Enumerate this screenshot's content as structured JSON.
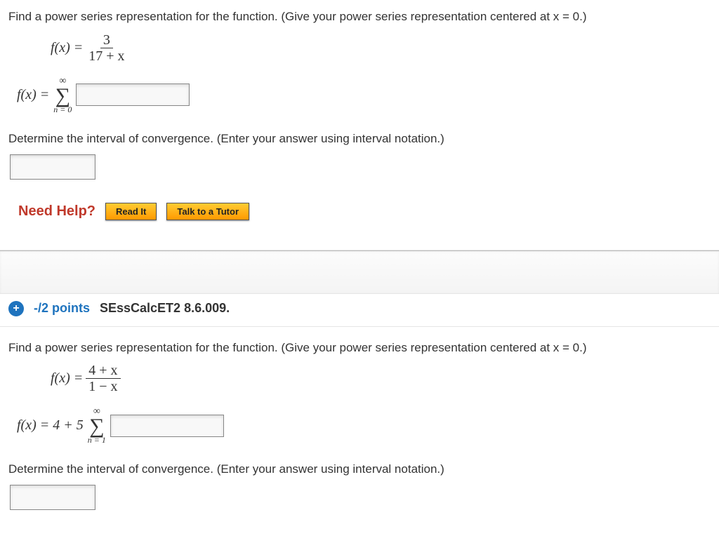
{
  "q1": {
    "prompt": "Find a power series representation for the function. (Give your power series representation centered at x = 0.)",
    "fx_lhs": "f(x) = ",
    "frac_num": "3",
    "frac_den": "17 + x",
    "answer_lhs": "f(x) = ",
    "sigma_top": "∞",
    "sigma_sym": "∑",
    "sigma_bottom": "n = 0",
    "interval_prompt": "Determine the interval of convergence. (Enter your answer using interval notation.)"
  },
  "help": {
    "label": "Need Help?",
    "read": "Read It",
    "tutor": "Talk to a Tutor"
  },
  "q2header": {
    "plus": "+",
    "points": "-/2 points",
    "code": "SEssCalcET2 8.6.009."
  },
  "q2": {
    "prompt": "Find a power series representation for the function. (Give your power series representation centered at x = 0.)",
    "fx_lhs": "f(x) = ",
    "frac_num": "4 + x",
    "frac_den": "1 − x",
    "answer_lhs": "f(x) = 4 + 5",
    "sigma_top": "∞",
    "sigma_sym": "∑",
    "sigma_bottom": "n = 1",
    "interval_prompt": "Determine the interval of convergence. (Enter your answer using interval notation.)"
  }
}
